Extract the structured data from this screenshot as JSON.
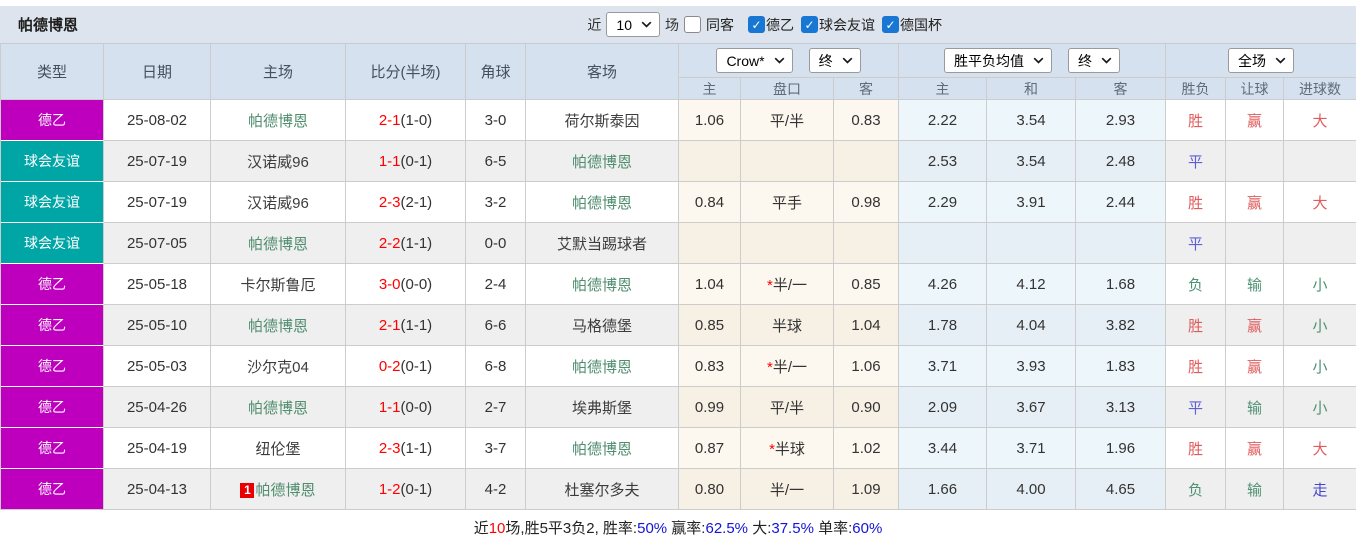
{
  "title": "帕德博恩",
  "filter": {
    "near_label": "近",
    "count": "10",
    "matches_label": "场",
    "same_away": {
      "label": "同客",
      "checked": false
    },
    "leagues": [
      {
        "label": "德乙",
        "checked": true
      },
      {
        "label": "球会友谊",
        "checked": true
      },
      {
        "label": "德国杯",
        "checked": true
      }
    ],
    "check_glyph": "✓"
  },
  "header": {
    "cols": [
      "类型",
      "日期",
      "主场",
      "比分(半场)",
      "角球",
      "客场"
    ],
    "selects": {
      "crow": "Crow*",
      "final1": "终",
      "avg": "胜平负均值",
      "final2": "终",
      "scope": "全场"
    },
    "sub": [
      "主",
      "盘口",
      "客",
      "主",
      "和",
      "客",
      "胜负",
      "让球",
      "进球数"
    ]
  },
  "type_colors": {
    "德乙": "#be00be",
    "球会友谊": "#00a5a5"
  },
  "accent_colors": {
    "target_team": "#4f8d6e",
    "score": "#ff0000",
    "win": "#e05c5c",
    "draw": "#5e5ed8",
    "lose": "#4f9173",
    "walk": "#4646cc"
  },
  "rows": [
    {
      "type": "德乙",
      "type_color": "#be00be",
      "date": "25-08-02",
      "home": "帕德博恩",
      "home_target": true,
      "home_badge": "",
      "score": "2-1",
      "half": "(1-0)",
      "corners": "3-0",
      "away": "荷尔斯泰因",
      "away_target": false,
      "odds_home": "1.06",
      "handicap": "平/半",
      "handicap_star": false,
      "odds_away": "0.83",
      "avg_home": "2.22",
      "avg_draw": "3.54",
      "avg_away": "2.93",
      "res_wdl": {
        "t": "胜",
        "c": "red"
      },
      "res_let": {
        "t": "赢",
        "c": "red"
      },
      "res_goal": {
        "t": "大",
        "c": "red"
      }
    },
    {
      "type": "球会友谊",
      "type_color": "#00a5a5",
      "date": "25-07-19",
      "home": "汉诺威96",
      "home_target": false,
      "home_badge": "",
      "score": "1-1",
      "half": "(0-1)",
      "corners": "6-5",
      "away": "帕德博恩",
      "away_target": true,
      "odds_home": "",
      "handicap": "",
      "handicap_star": false,
      "odds_away": "",
      "avg_home": "2.53",
      "avg_draw": "3.54",
      "avg_away": "2.48",
      "res_wdl": {
        "t": "平",
        "c": "blue"
      },
      "res_let": null,
      "res_goal": null
    },
    {
      "type": "球会友谊",
      "type_color": "#00a5a5",
      "date": "25-07-19",
      "home": "汉诺威96",
      "home_target": false,
      "home_badge": "",
      "score": "2-3",
      "half": "(2-1)",
      "corners": "3-2",
      "away": "帕德博恩",
      "away_target": true,
      "odds_home": "0.84",
      "handicap": "平手",
      "handicap_star": false,
      "odds_away": "0.98",
      "avg_home": "2.29",
      "avg_draw": "3.91",
      "avg_away": "2.44",
      "res_wdl": {
        "t": "胜",
        "c": "red"
      },
      "res_let": {
        "t": "赢",
        "c": "red"
      },
      "res_goal": {
        "t": "大",
        "c": "red"
      }
    },
    {
      "type": "球会友谊",
      "type_color": "#00a5a5",
      "date": "25-07-05",
      "home": "帕德博恩",
      "home_target": true,
      "home_badge": "",
      "score": "2-2",
      "half": "(1-1)",
      "corners": "0-0",
      "away": "艾默当踢球者",
      "away_target": false,
      "odds_home": "",
      "handicap": "",
      "handicap_star": false,
      "odds_away": "",
      "avg_home": "",
      "avg_draw": "",
      "avg_away": "",
      "res_wdl": {
        "t": "平",
        "c": "blue"
      },
      "res_let": null,
      "res_goal": null
    },
    {
      "type": "德乙",
      "type_color": "#be00be",
      "date": "25-05-18",
      "home": "卡尔斯鲁厄",
      "home_target": false,
      "home_badge": "",
      "score": "3-0",
      "half": "(0-0)",
      "corners": "2-4",
      "away": "帕德博恩",
      "away_target": true,
      "odds_home": "1.04",
      "handicap": "半/一",
      "handicap_star": true,
      "odds_away": "0.85",
      "avg_home": "4.26",
      "avg_draw": "4.12",
      "avg_away": "1.68",
      "res_wdl": {
        "t": "负",
        "c": "green"
      },
      "res_let": {
        "t": "输",
        "c": "green"
      },
      "res_goal": {
        "t": "小",
        "c": "green"
      }
    },
    {
      "type": "德乙",
      "type_color": "#be00be",
      "date": "25-05-10",
      "home": "帕德博恩",
      "home_target": true,
      "home_badge": "",
      "score": "2-1",
      "half": "(1-1)",
      "corners": "6-6",
      "away": "马格德堡",
      "away_target": false,
      "odds_home": "0.85",
      "handicap": "半球",
      "handicap_star": false,
      "odds_away": "1.04",
      "avg_home": "1.78",
      "avg_draw": "4.04",
      "avg_away": "3.82",
      "res_wdl": {
        "t": "胜",
        "c": "red"
      },
      "res_let": {
        "t": "赢",
        "c": "red"
      },
      "res_goal": {
        "t": "小",
        "c": "green"
      }
    },
    {
      "type": "德乙",
      "type_color": "#be00be",
      "date": "25-05-03",
      "home": "沙尔克04",
      "home_target": false,
      "home_badge": "",
      "score": "0-2",
      "half": "(0-1)",
      "corners": "6-8",
      "away": "帕德博恩",
      "away_target": true,
      "odds_home": "0.83",
      "handicap": "半/一",
      "handicap_star": true,
      "odds_away": "1.06",
      "avg_home": "3.71",
      "avg_draw": "3.93",
      "avg_away": "1.83",
      "res_wdl": {
        "t": "胜",
        "c": "red"
      },
      "res_let": {
        "t": "赢",
        "c": "red"
      },
      "res_goal": {
        "t": "小",
        "c": "green"
      }
    },
    {
      "type": "德乙",
      "type_color": "#be00be",
      "date": "25-04-26",
      "home": "帕德博恩",
      "home_target": true,
      "home_badge": "",
      "score": "1-1",
      "half": "(0-0)",
      "corners": "2-7",
      "away": "埃弗斯堡",
      "away_target": false,
      "odds_home": "0.99",
      "handicap": "平/半",
      "handicap_star": false,
      "odds_away": "0.90",
      "avg_home": "2.09",
      "avg_draw": "3.67",
      "avg_away": "3.13",
      "res_wdl": {
        "t": "平",
        "c": "blue"
      },
      "res_let": {
        "t": "输",
        "c": "green"
      },
      "res_goal": {
        "t": "小",
        "c": "green"
      }
    },
    {
      "type": "德乙",
      "type_color": "#be00be",
      "date": "25-04-19",
      "home": "纽伦堡",
      "home_target": false,
      "home_badge": "",
      "score": "2-3",
      "half": "(1-1)",
      "corners": "3-7",
      "away": "帕德博恩",
      "away_target": true,
      "odds_home": "0.87",
      "handicap": "半球",
      "handicap_star": true,
      "odds_away": "1.02",
      "avg_home": "3.44",
      "avg_draw": "3.71",
      "avg_away": "1.96",
      "res_wdl": {
        "t": "胜",
        "c": "red"
      },
      "res_let": {
        "t": "赢",
        "c": "red"
      },
      "res_goal": {
        "t": "大",
        "c": "red"
      }
    },
    {
      "type": "德乙",
      "type_color": "#be00be",
      "date": "25-04-13",
      "home": "帕德博恩",
      "home_target": true,
      "home_badge": "1",
      "score": "1-2",
      "half": "(0-1)",
      "corners": "4-2",
      "away": "杜塞尔多夫",
      "away_target": false,
      "odds_home": "0.80",
      "handicap": "半/一",
      "handicap_star": false,
      "odds_away": "1.09",
      "avg_home": "1.66",
      "avg_draw": "4.00",
      "avg_away": "4.65",
      "res_wdl": {
        "t": "负",
        "c": "green"
      },
      "res_let": {
        "t": "输",
        "c": "green"
      },
      "res_goal": {
        "t": "走",
        "c": "walk"
      }
    }
  ],
  "footer": {
    "segments": [
      {
        "text": "近",
        "color": "black"
      },
      {
        "text": "10",
        "color": "red"
      },
      {
        "text": "场,胜5平3负2, 胜率:",
        "color": "black"
      },
      {
        "text": "50%",
        "color": "blue"
      },
      {
        "text": " 赢率:",
        "color": "black"
      },
      {
        "text": "62.5%",
        "color": "blue"
      },
      {
        "text": " 大:",
        "color": "black"
      },
      {
        "text": "37.5%",
        "color": "blue"
      },
      {
        "text": " 单率:",
        "color": "black"
      },
      {
        "text": "60%",
        "color": "blue"
      }
    ]
  }
}
